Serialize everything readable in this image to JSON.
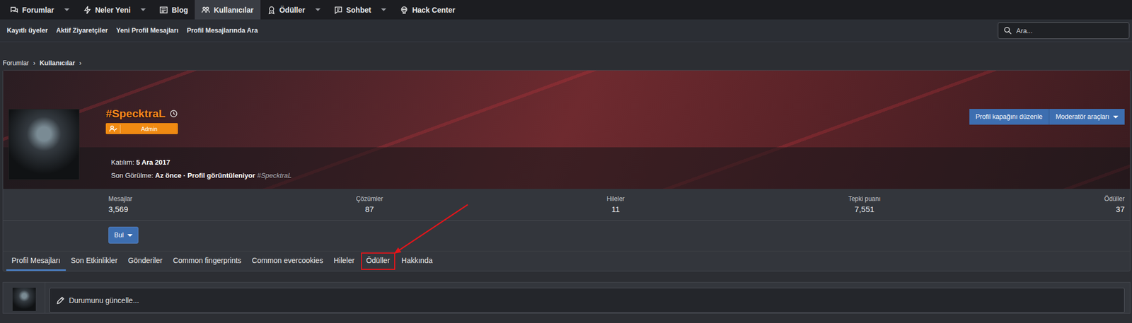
{
  "nav": {
    "items": [
      {
        "label": "Forumlar",
        "dropdown": true,
        "selected": false
      },
      {
        "label": "Neler Yeni",
        "dropdown": true,
        "selected": false
      },
      {
        "label": "Blog",
        "dropdown": false,
        "selected": false
      },
      {
        "label": "Kullanıcılar",
        "dropdown": false,
        "selected": true
      },
      {
        "label": "Ödüller",
        "dropdown": true,
        "selected": false
      },
      {
        "label": "Sohbet",
        "dropdown": true,
        "selected": false
      },
      {
        "label": "Hack Center",
        "dropdown": false,
        "selected": false
      }
    ]
  },
  "subnav": {
    "items": [
      "Kayıtlı üyeler",
      "Aktif Ziyaretçiler",
      "Yeni Profil Mesajları",
      "Profil Mesajlarında Ara"
    ]
  },
  "search": {
    "placeholder": "Ara..."
  },
  "breadcrumb": {
    "items": [
      "Forumlar",
      "Kullanıcılar"
    ],
    "separator": "›"
  },
  "profile": {
    "name": "#SpecktraL",
    "badge": "Admin",
    "joined_label": "Katılım:",
    "joined": "5 Ara 2017",
    "last_seen_label": "Son Görülme:",
    "last_seen": "Az önce · Profil görüntüleniyor",
    "last_seen_user": "#SpecktraL"
  },
  "banner_buttons": [
    {
      "label": "Profil kapağını düzenle",
      "dropdown": false
    },
    {
      "label": "Moderatör araçları",
      "dropdown": true
    }
  ],
  "stats": [
    {
      "label": "Mesajlar",
      "value": "3,569"
    },
    {
      "label": "Çözümler",
      "value": "87"
    },
    {
      "label": "Hileler",
      "value": "11"
    },
    {
      "label": "Tepki puanı",
      "value": "7,551"
    },
    {
      "label": "Ödüller",
      "value": "37"
    }
  ],
  "find_button": {
    "label": "Bul",
    "dropdown": true
  },
  "tabs": [
    {
      "label": "Profil Mesajları",
      "selected": true,
      "highlighted": false
    },
    {
      "label": "Son Etkinlikler",
      "selected": false,
      "highlighted": false
    },
    {
      "label": "Gönderiler",
      "selected": false,
      "highlighted": false
    },
    {
      "label": "Common fingerprints",
      "selected": false,
      "highlighted": false
    },
    {
      "label": "Common evercookies",
      "selected": false,
      "highlighted": false
    },
    {
      "label": "Hileler",
      "selected": false,
      "highlighted": false
    },
    {
      "label": "Ödüller",
      "selected": false,
      "highlighted": true
    },
    {
      "label": "Hakkında",
      "selected": false,
      "highlighted": false
    }
  ],
  "status": {
    "placeholder": "Durumunu güncelle..."
  }
}
